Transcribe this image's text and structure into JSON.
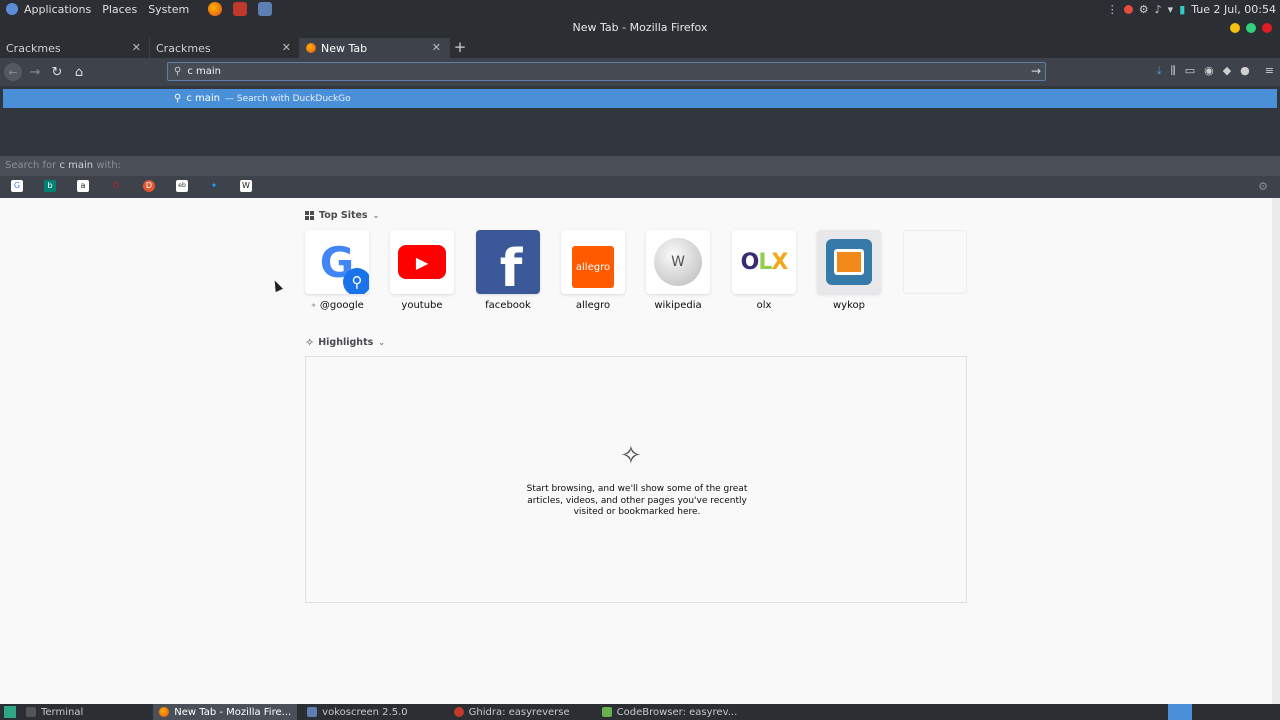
{
  "top_panel": {
    "menus": [
      "Applications",
      "Places",
      "System"
    ],
    "clock": "Tue 2 Jul, 00:54"
  },
  "window": {
    "title": "New Tab - Mozilla Firefox"
  },
  "tabs": [
    {
      "label": "Crackmes"
    },
    {
      "label": "Crackmes"
    },
    {
      "label": "New Tab"
    }
  ],
  "nav": {
    "url_value": "c main"
  },
  "dropdown": {
    "suggestion_query": "c main",
    "suggestion_engine": "— Search with DuckDuckGo",
    "oneoff_prefix": "Search for",
    "oneoff_query": "c main",
    "oneoff_suffix": "with:"
  },
  "top_sites": {
    "heading": "Top Sites",
    "sites": [
      {
        "label": "@google"
      },
      {
        "label": "youtube"
      },
      {
        "label": "facebook"
      },
      {
        "label": "allegro"
      },
      {
        "label": "wikipedia"
      },
      {
        "label": "olx"
      },
      {
        "label": "wykop"
      }
    ]
  },
  "highlights": {
    "heading": "Highlights",
    "empty_text": "Start browsing, and we'll show some of the great articles, videos, and other pages you've recently visited or bookmarked here."
  },
  "taskbar": {
    "tasks": [
      {
        "label": "Terminal"
      },
      {
        "label": "New Tab - Mozilla Fire..."
      },
      {
        "label": "vokoscreen 2.5.0"
      },
      {
        "label": "Ghidra: easyreverse"
      },
      {
        "label": "CodeBrowser: easyrev..."
      }
    ]
  },
  "colors": {
    "accent": "#4a90d9",
    "chrome_dark": "#2b2e33",
    "toolbar": "#3e424a"
  }
}
